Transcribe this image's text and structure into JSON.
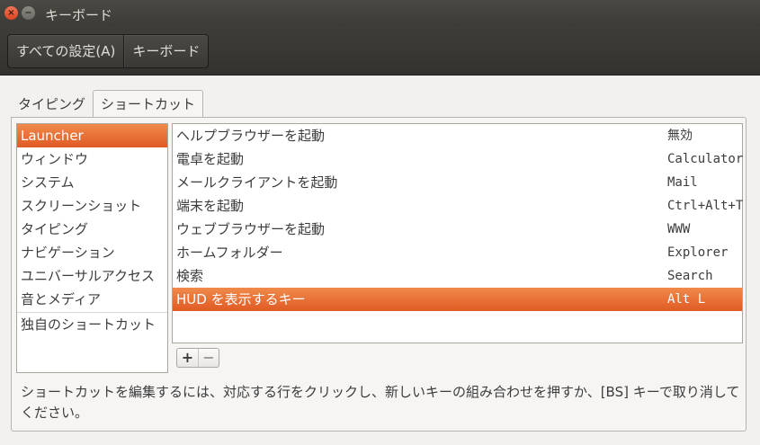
{
  "window": {
    "close_glyph": "×",
    "minimize_glyph": "−",
    "title": "キーボード"
  },
  "breadcrumb": {
    "items": [
      {
        "label": "すべての設定(A)"
      },
      {
        "label": "キーボード"
      }
    ]
  },
  "tabs": [
    {
      "label": "タイピング",
      "active": false
    },
    {
      "label": "ショートカット",
      "active": true
    }
  ],
  "categories": {
    "items": [
      {
        "label": "Launcher",
        "selected": true
      },
      {
        "label": "ウィンドウ"
      },
      {
        "label": "システム"
      },
      {
        "label": "スクリーンショット"
      },
      {
        "label": "タイピング"
      },
      {
        "label": "ナビゲーション"
      },
      {
        "label": "ユニバーサルアクセス"
      },
      {
        "label": "音とメディア"
      }
    ],
    "custom": {
      "label": "独自のショートカット"
    }
  },
  "shortcuts": {
    "rows": [
      {
        "name": "ヘルプブラウザーを起動",
        "key": "無効"
      },
      {
        "name": "電卓を起動",
        "key": "Calculator"
      },
      {
        "name": "メールクライアントを起動",
        "key": "Mail"
      },
      {
        "name": "端末を起動",
        "key": "Ctrl+Alt+T"
      },
      {
        "name": "ウェブブラウザーを起動",
        "key": "WWW"
      },
      {
        "name": "ホームフォルダー",
        "key": "Explorer"
      },
      {
        "name": "検索",
        "key": "Search"
      },
      {
        "name": "HUD を表示するキー",
        "key": "Alt L",
        "selected": true
      }
    ]
  },
  "controls": {
    "add_label": "+",
    "remove_label": "−"
  },
  "help": {
    "text": "ショートカットを編集するには、対応する行をクリックし、新しいキーの組み合わせを押すか、[BS] キーで取り消してください。"
  },
  "colors": {
    "selection": "#e9692c",
    "titlebar": "#3c3b37",
    "window_bg": "#f2f1f0"
  }
}
